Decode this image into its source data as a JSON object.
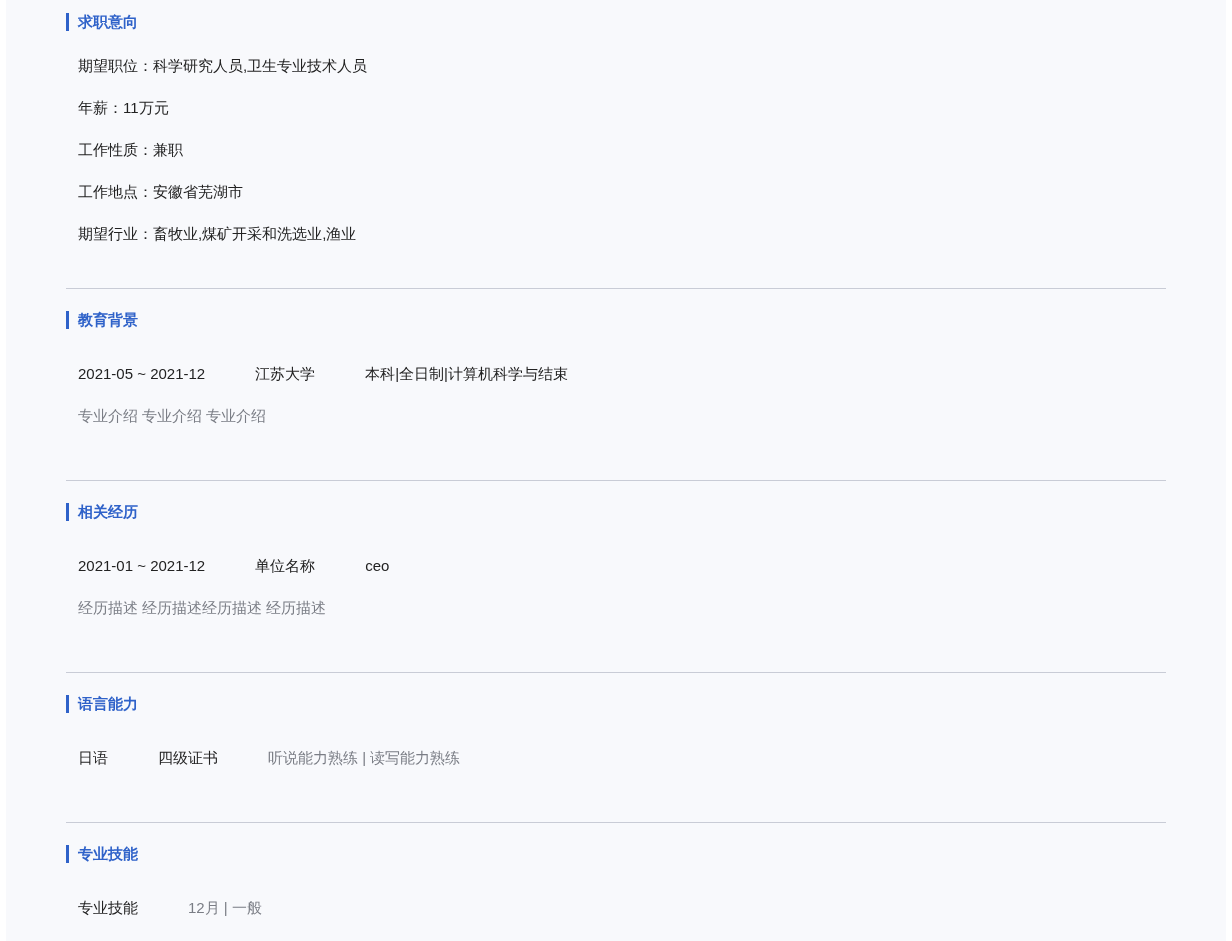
{
  "sections": [
    {
      "kind": "fields",
      "title": "求职意向",
      "items": [
        "期望职位：科学研究人员,卫生专业技术人员",
        "年薪：11万元",
        "工作性质：兼职",
        "工作地点：安徽省芜湖市",
        "期望行业：畜牧业,煤矿开采和洗选业,渔业"
      ]
    },
    {
      "kind": "entries",
      "title": "教育背景",
      "entries": [
        {
          "columns": [
            {
              "text": "2021-05 ~ 2021-12",
              "muted": false
            },
            {
              "text": "江苏大学",
              "muted": false
            },
            {
              "text": "本科|全日制|计算机科学与结束",
              "muted": false
            }
          ],
          "description": "专业介绍 专业介绍 专业介绍"
        }
      ]
    },
    {
      "kind": "entries",
      "title": "相关经历",
      "entries": [
        {
          "columns": [
            {
              "text": "2021-01 ~ 2021-12",
              "muted": false
            },
            {
              "text": "单位名称",
              "muted": false
            },
            {
              "text": "ceo",
              "muted": false
            }
          ],
          "description": "经历描述 经历描述经历描述 经历描述"
        }
      ]
    },
    {
      "kind": "entries",
      "title": "语言能力",
      "entries": [
        {
          "columns": [
            {
              "text": "日语",
              "muted": false
            },
            {
              "text": "四级证书",
              "muted": false
            },
            {
              "text": "听说能力熟练 | 读写能力熟练",
              "muted": true
            }
          ]
        }
      ]
    },
    {
      "kind": "entries",
      "title": "专业技能",
      "entries": [
        {
          "columns": [
            {
              "text": "专业技能",
              "muted": false
            },
            {
              "text": "12月 | 一般",
              "muted": true
            }
          ]
        }
      ]
    }
  ]
}
